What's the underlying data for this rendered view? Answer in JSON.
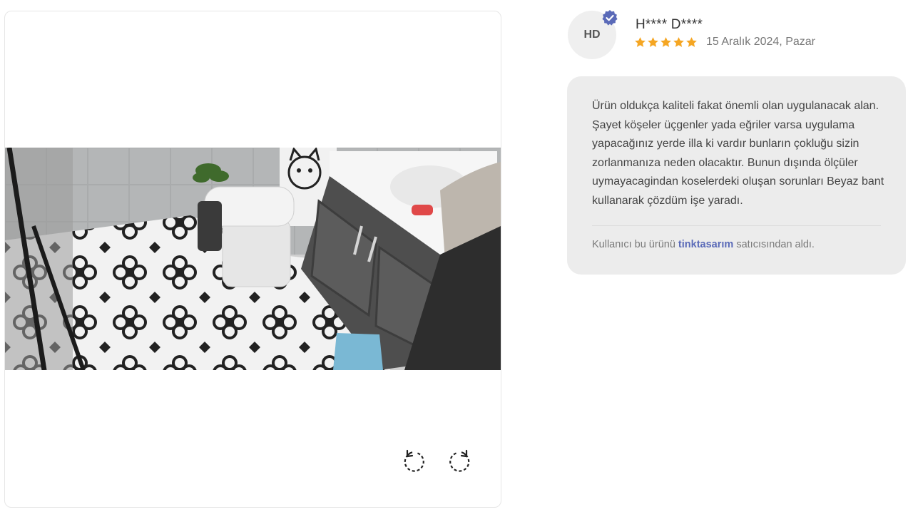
{
  "viewer": {
    "photo_alt": "",
    "rotate_left": "rotate-left",
    "rotate_right": "rotate-right"
  },
  "review": {
    "avatar_initials": "HD",
    "user_name": "H**** D****",
    "rating": 5,
    "rating_max": 5,
    "date": "15 Aralık 2024, Pazar",
    "text": "Ürün oldukça kaliteli fakat önemli olan uygulanacak alan. Şayet köşeler üçgenler yada eğriler varsa uygulama yapacağınız yerde illa ki vardır bunların çokluğu sizin zorlanmanıza neden olacaktır. Bunun dışında ölçüler uymayacagindan koselerdeki oluşan sorunları Beyaz bant kullanarak çözdüm işe yaradı.",
    "seller_prefix": "Kullanıcı bu ürünü",
    "seller_name": "tinktasarım",
    "seller_suffix": "satıcısından aldı."
  },
  "colors": {
    "star": "#f5a623",
    "verified": "#5a6ab8",
    "link": "#5a6ab8",
    "card_bg": "#ececec"
  },
  "icons": {
    "verified": "verified-check-icon",
    "star": "star-icon",
    "rotate_left": "rotate-left-icon",
    "rotate_right": "rotate-right-icon"
  }
}
